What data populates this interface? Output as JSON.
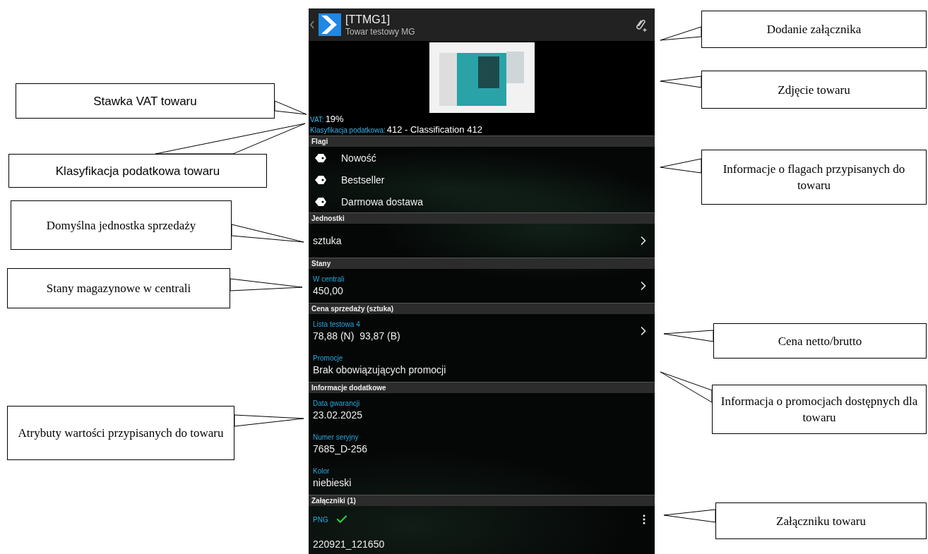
{
  "header": {
    "code": "[TTMG1]",
    "name": "Towar testowy MG"
  },
  "vat": {
    "label": "VAT:",
    "value": "19%"
  },
  "tax_class": {
    "label": "Klasyfikacja podatkowa:",
    "value": "412 - Classification 412"
  },
  "sections": [
    {
      "title": "Flagi",
      "kind": "flags",
      "items": [
        "Nowość",
        "Bestseller",
        "Darmowa dostawa"
      ]
    },
    {
      "title": "Jednostki",
      "kind": "rows",
      "rows": [
        {
          "value": "sztuka",
          "chevron": true
        }
      ]
    },
    {
      "title": "Stany",
      "kind": "rows",
      "rows": [
        {
          "label": "W centrali",
          "value": "450,00",
          "chevron": true
        }
      ]
    },
    {
      "title": "Cena sprzedaży (sztuka)",
      "kind": "rows",
      "rows": [
        {
          "label": "Lista testowa 4",
          "value": "78,88 (N)  93,87 (B)",
          "chevron": true
        },
        {
          "label": "Promocje",
          "value": "Brak obowiązujących promocji",
          "chevron": false
        }
      ]
    },
    {
      "title": "Informacje dodatkowe",
      "kind": "rows",
      "rows": [
        {
          "label": "Data gwarancji",
          "value": "23.02.2025",
          "chevron": false
        },
        {
          "label": "Numer seryjny",
          "value": "7685_D-256",
          "chevron": false
        },
        {
          "label": "Kolor",
          "value": "niebieski",
          "chevron": false
        }
      ]
    },
    {
      "title": "Załączniki (1)",
      "kind": "attachments",
      "items": [
        {
          "type": "PNG",
          "synced": true,
          "name": "220921_121650"
        }
      ]
    }
  ],
  "callouts": [
    {
      "text": "Dodanie załącznika"
    },
    {
      "text": "Zdjęcie towaru"
    },
    {
      "text": "Stawka VAT towaru"
    },
    {
      "text": "Klasyfikacja podatkowa towaru"
    },
    {
      "text": "Informacje o flagach przypisanych do towaru"
    },
    {
      "text": "Domyślna jednostka sprzedaży"
    },
    {
      "text": "Stany magazynowe w centrali"
    },
    {
      "text": "Cena netto/brutto"
    },
    {
      "text": "Informacja o promocjach dostępnych dla towaru"
    },
    {
      "text": "Atrybuty wartości przypisanych do towaru"
    },
    {
      "text": "Załączniku towaru"
    }
  ]
}
